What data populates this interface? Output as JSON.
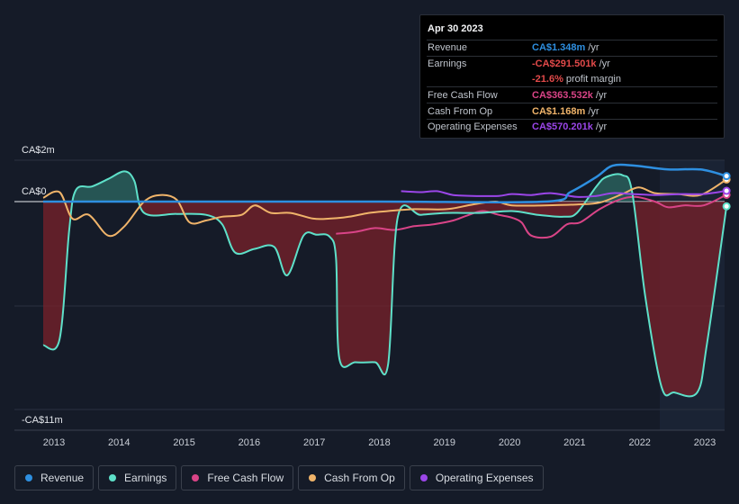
{
  "chart_data": {
    "type": "line",
    "ylabel_top": "CA$2m",
    "ylabel_zero": "CA$0",
    "ylabel_bottom": "-CA$11m",
    "ylim": [
      -11,
      2
    ],
    "x_ticks": [
      "2013",
      "2014",
      "2015",
      "2016",
      "2017",
      "2018",
      "2019",
      "2020",
      "2021",
      "2022",
      "2023"
    ],
    "series": [
      {
        "name": "Revenue",
        "color": "#2e8fe0",
        "points": [
          [
            2012.8,
            0
          ],
          [
            2015,
            0
          ],
          [
            2018,
            0
          ],
          [
            2020.5,
            0
          ],
          [
            2020.9,
            0.5
          ],
          [
            2021.3,
            1.3
          ],
          [
            2021.55,
            1.9
          ],
          [
            2021.9,
            1.9
          ],
          [
            2022.4,
            1.7
          ],
          [
            2022.9,
            1.7
          ],
          [
            2023.3,
            1.35
          ]
        ]
      },
      {
        "name": "Earnings",
        "color": "#5ee0c9",
        "points": [
          [
            2012.8,
            -7.6
          ],
          [
            2013.05,
            -7.3
          ],
          [
            2013.2,
            -1.5
          ],
          [
            2013.3,
            0.6
          ],
          [
            2013.55,
            0.8
          ],
          [
            2013.8,
            1.2
          ],
          [
            2014.05,
            1.6
          ],
          [
            2014.2,
            1.1
          ],
          [
            2014.35,
            -0.6
          ],
          [
            2014.85,
            -0.65
          ],
          [
            2015.3,
            -0.7
          ],
          [
            2015.55,
            -1.2
          ],
          [
            2015.75,
            -2.7
          ],
          [
            2016.05,
            -2.5
          ],
          [
            2016.35,
            -2.4
          ],
          [
            2016.55,
            -3.9
          ],
          [
            2016.8,
            -1.8
          ],
          [
            2017.0,
            -1.75
          ],
          [
            2017.2,
            -1.85
          ],
          [
            2017.3,
            -3.0
          ],
          [
            2017.35,
            -8.3
          ],
          [
            2017.6,
            -8.5
          ],
          [
            2017.9,
            -8.5
          ],
          [
            2018.1,
            -8.6
          ],
          [
            2018.25,
            -0.8
          ],
          [
            2018.6,
            -0.7
          ],
          [
            2019.0,
            -0.6
          ],
          [
            2019.5,
            -0.6
          ],
          [
            2020.0,
            -0.5
          ],
          [
            2020.4,
            -0.7
          ],
          [
            2020.8,
            -0.8
          ],
          [
            2021.0,
            -0.6
          ],
          [
            2021.3,
            0.8
          ],
          [
            2021.45,
            1.3
          ],
          [
            2021.7,
            1.4
          ],
          [
            2021.85,
            0.5
          ],
          [
            2022.05,
            -5.0
          ],
          [
            2022.3,
            -9.8
          ],
          [
            2022.5,
            -10.1
          ],
          [
            2022.85,
            -10.1
          ],
          [
            2023.0,
            -7.5
          ],
          [
            2023.3,
            -0.25
          ]
        ]
      },
      {
        "name": "Free Cash Flow",
        "color": "#d94487",
        "points": [
          [
            2017.3,
            -1.7
          ],
          [
            2017.6,
            -1.6
          ],
          [
            2017.9,
            -1.4
          ],
          [
            2018.2,
            -1.5
          ],
          [
            2018.5,
            -1.3
          ],
          [
            2018.8,
            -1.2
          ],
          [
            2019.1,
            -1.0
          ],
          [
            2019.3,
            -0.75
          ],
          [
            2019.55,
            -0.5
          ],
          [
            2019.8,
            -0.7
          ],
          [
            2020.0,
            -0.85
          ],
          [
            2020.15,
            -1.1
          ],
          [
            2020.3,
            -1.8
          ],
          [
            2020.6,
            -1.85
          ],
          [
            2020.85,
            -1.2
          ],
          [
            2021.05,
            -1.1
          ],
          [
            2021.35,
            -0.4
          ],
          [
            2021.65,
            0.1
          ],
          [
            2021.9,
            0.25
          ],
          [
            2022.2,
            0.0
          ],
          [
            2022.4,
            -0.3
          ],
          [
            2022.65,
            -0.2
          ],
          [
            2022.95,
            -0.2
          ],
          [
            2023.3,
            0.36
          ]
        ]
      },
      {
        "name": "Cash From Op",
        "color": "#f0b46a",
        "points": [
          [
            2012.8,
            0.2
          ],
          [
            2013.05,
            0.5
          ],
          [
            2013.25,
            -0.9
          ],
          [
            2013.5,
            -0.7
          ],
          [
            2013.8,
            -1.8
          ],
          [
            2014.05,
            -1.3
          ],
          [
            2014.35,
            0.0
          ],
          [
            2014.6,
            0.35
          ],
          [
            2014.85,
            0.1
          ],
          [
            2015.05,
            -1.1
          ],
          [
            2015.3,
            -1.0
          ],
          [
            2015.55,
            -0.8
          ],
          [
            2015.85,
            -0.7
          ],
          [
            2016.05,
            -0.2
          ],
          [
            2016.3,
            -0.6
          ],
          [
            2016.6,
            -0.6
          ],
          [
            2016.95,
            -0.9
          ],
          [
            2017.2,
            -0.9
          ],
          [
            2017.5,
            -0.8
          ],
          [
            2017.8,
            -0.6
          ],
          [
            2018.1,
            -0.5
          ],
          [
            2018.5,
            -0.4
          ],
          [
            2019.0,
            -0.4
          ],
          [
            2019.4,
            -0.15
          ],
          [
            2019.75,
            0.0
          ],
          [
            2020.0,
            -0.2
          ],
          [
            2020.5,
            -0.2
          ],
          [
            2021.0,
            -0.15
          ],
          [
            2021.35,
            -0.05
          ],
          [
            2021.7,
            0.4
          ],
          [
            2021.95,
            0.75
          ],
          [
            2022.2,
            0.45
          ],
          [
            2022.55,
            0.4
          ],
          [
            2022.9,
            0.35
          ],
          [
            2023.3,
            1.17
          ]
        ]
      },
      {
        "name": "Operating Expenses",
        "color": "#9b46e8",
        "points": [
          [
            2018.3,
            0.55
          ],
          [
            2018.6,
            0.5
          ],
          [
            2018.85,
            0.55
          ],
          [
            2019.1,
            0.35
          ],
          [
            2019.4,
            0.3
          ],
          [
            2019.8,
            0.3
          ],
          [
            2020.0,
            0.4
          ],
          [
            2020.3,
            0.35
          ],
          [
            2020.6,
            0.45
          ],
          [
            2021.0,
            0.25
          ],
          [
            2021.3,
            0.3
          ],
          [
            2021.55,
            0.45
          ],
          [
            2021.85,
            0.4
          ],
          [
            2022.2,
            0.35
          ],
          [
            2022.6,
            0.4
          ],
          [
            2022.95,
            0.4
          ],
          [
            2023.3,
            0.57
          ]
        ]
      }
    ]
  },
  "tooltip": {
    "date": "Apr 30 2023",
    "rows": [
      {
        "key": "Revenue",
        "value": "CA$1.348m",
        "unit": "/yr",
        "color": "#2e8fe0"
      },
      {
        "key": "Earnings",
        "value": "-CA$291.501k",
        "unit": "/yr",
        "color": "#e34a4a"
      },
      {
        "key": "",
        "value": "-21.6%",
        "unit": "profit margin",
        "color": "#e34a4a"
      },
      {
        "key": "Free Cash Flow",
        "value": "CA$363.532k",
        "unit": "/yr",
        "color": "#d94487"
      },
      {
        "key": "Cash From Op",
        "value": "CA$1.168m",
        "unit": "/yr",
        "color": "#f0b46a"
      },
      {
        "key": "Operating Expenses",
        "value": "CA$570.201k",
        "unit": "/yr",
        "color": "#9b46e8"
      }
    ]
  },
  "legend": [
    {
      "label": "Revenue",
      "color": "#2e8fe0"
    },
    {
      "label": "Earnings",
      "color": "#5ee0c9"
    },
    {
      "label": "Free Cash Flow",
      "color": "#d94487"
    },
    {
      "label": "Cash From Op",
      "color": "#f0b46a"
    },
    {
      "label": "Operating Expenses",
      "color": "#9b46e8"
    }
  ]
}
